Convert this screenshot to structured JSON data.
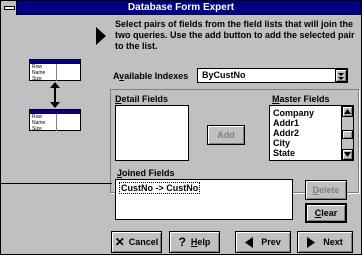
{
  "window": {
    "title": "Database Form Expert"
  },
  "instructions": "Select pairs of fields from the field lists that will join the two queries.  Use the add button to add the selected pair to the list.",
  "available_indexes": {
    "label_prefix": "A",
    "label_access": "v",
    "label_suffix": "ailable Indexes",
    "value": "ByCustNo"
  },
  "detail_fields": {
    "label_access": "D",
    "label_suffix": "etail Fields",
    "items": []
  },
  "master_fields": {
    "label_access": "M",
    "label_suffix": "aster Fields",
    "items": [
      "Company",
      "Addr1",
      "Addr2",
      "City",
      "State"
    ]
  },
  "joined_fields": {
    "label_access": "J",
    "label_suffix": "oined Fields",
    "items": [
      "CustNo -> CustNo"
    ]
  },
  "buttons": {
    "add": "Add",
    "delete_access": "D",
    "delete_suffix": "elete",
    "clear_access": "C",
    "clear_suffix": "lear",
    "cancel": "Cancel",
    "help_access": "H",
    "help_suffix": "elp",
    "prev": "Prev",
    "next": "Next"
  },
  "illustration": {
    "top_table_rows": [
      "Row",
      "Name",
      "Size"
    ],
    "bottom_table_rows": [
      "Row",
      "Name",
      "Size"
    ]
  }
}
